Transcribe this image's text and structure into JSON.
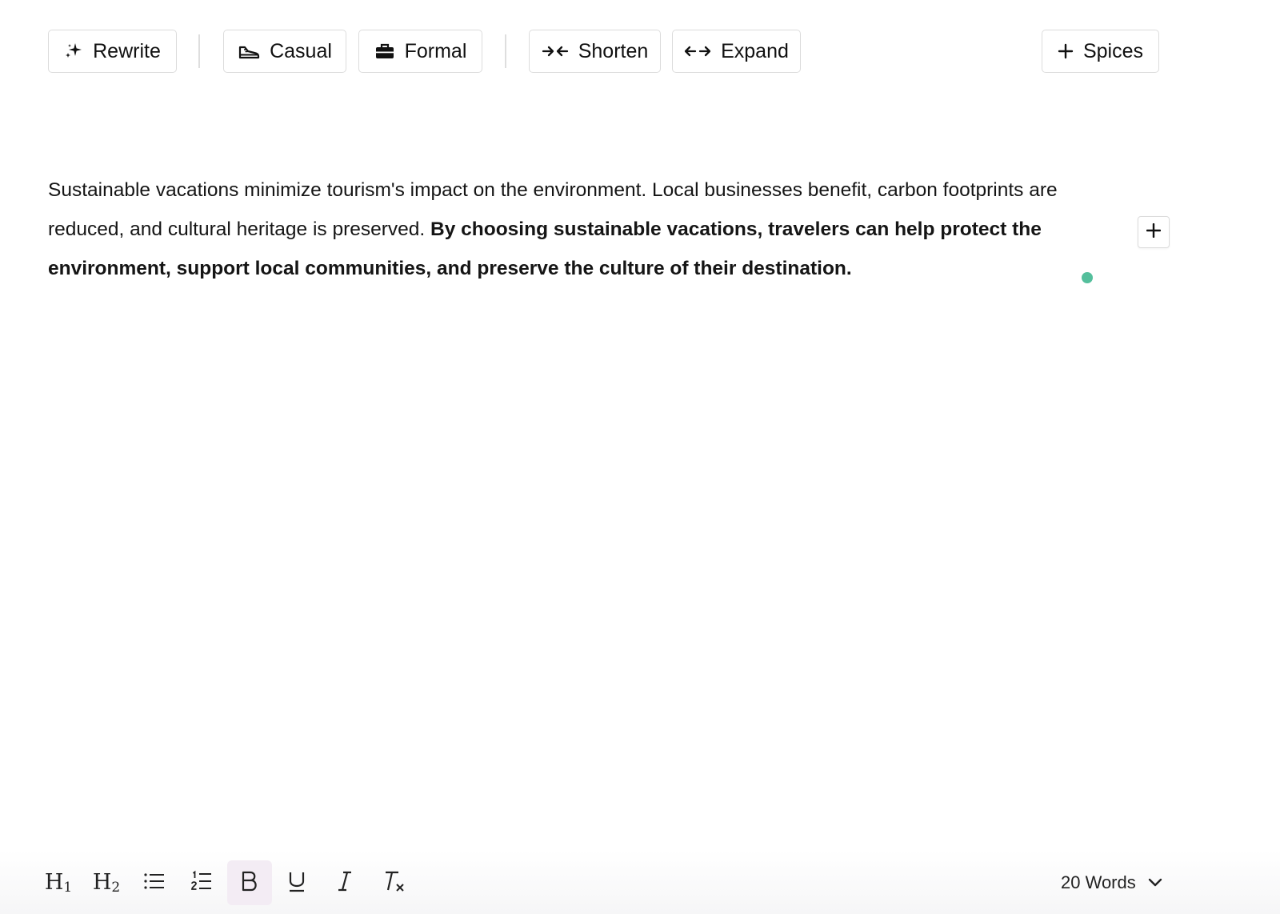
{
  "toolbar": {
    "rewrite_label": "Rewrite",
    "casual_label": "Casual",
    "formal_label": "Formal",
    "shorten_label": "Shorten",
    "expand_label": "Expand",
    "spices_label": "Spices"
  },
  "editor": {
    "text_plain": "Sustainable vacations minimize tourism's impact on the environment. Local businesses benefit, carbon footprints are reduced, and cultural heritage is preserved. ",
    "text_bold": "By choosing sustainable vacations, travelers can help protect the environment, support local communities, and preserve the culture of their destination."
  },
  "format_bar": {
    "h1_label": "H",
    "h1_sub": "1",
    "h2_label": "H",
    "h2_sub": "2",
    "word_count": "20 Words"
  },
  "colors": {
    "status_dot": "#54bf9c",
    "active_format_bg": "#f3ecf4"
  },
  "icons": {
    "rewrite": "sparkle-icon",
    "casual": "sneaker-icon",
    "formal": "briefcase-icon",
    "shorten": "arrows-inward-icon",
    "expand": "arrows-outward-icon",
    "spices": "plus-icon"
  }
}
